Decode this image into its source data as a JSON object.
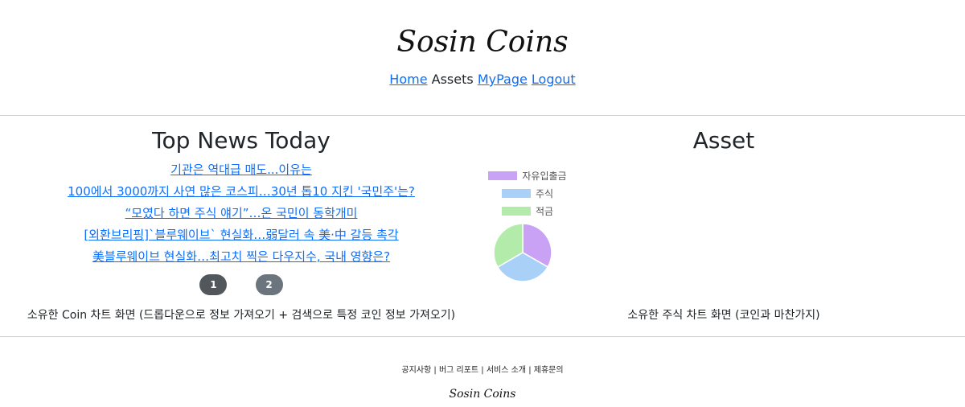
{
  "header": {
    "brand": "Sosin Coins",
    "nav": {
      "home": "Home",
      "assets": "Assets",
      "mypage": "MyPage",
      "logout": "Logout"
    }
  },
  "news": {
    "title": "Top News Today",
    "items": [
      "기관은 역대급 매도...이유는",
      "100에서 3000까지 사연 많은 코스피…30년 톱10 지킨 '국민주'는?",
      "“모였다 하면 주식 얘기”…온 국민이 동학개미",
      "[외환브리핑]`블루웨이브` 현실화…弱달러 속 美·中 갈등 촉각",
      "美블루웨이브 현실화…최고치 찍은 다우지수, 국내 영향은?"
    ],
    "pages": [
      "1",
      "2"
    ],
    "coin_note": "소유한 Coin 차트 화면 (드롭다운으로 정보 가져오기 + 검색으로 특정 코인 정보 가져오기)"
  },
  "asset": {
    "title": "Asset",
    "stock_note": "소유한 주식 차트 화면 (코인과 마찬가지)"
  },
  "chart_data": {
    "type": "pie",
    "categories": [
      "자유입출금",
      "주식",
      "적금"
    ],
    "values": [
      33.3,
      33.3,
      33.4
    ],
    "colors": [
      "#c9a2f5",
      "#a9d0f7",
      "#b3ecaa"
    ],
    "legend": "top"
  },
  "footer": {
    "links": "공지사항 | 버그 리포트 | 서비스 소개 | 제휴문의",
    "brand": "Sosin Coins"
  }
}
